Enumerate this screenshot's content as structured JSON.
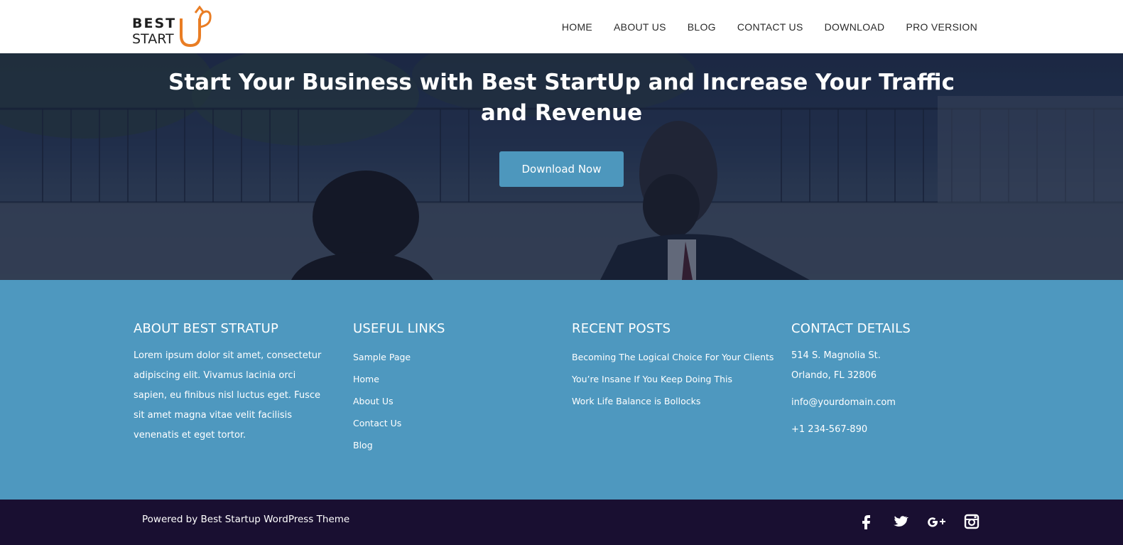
{
  "header": {
    "logo": {
      "best": "BEST",
      "start": "START",
      "up": "UP",
      "accent": "#e97d24"
    },
    "nav": [
      "HOME",
      "ABOUT US",
      "BLOG",
      "CONTACT US",
      "DOWNLOAD",
      "PRO VERSION"
    ]
  },
  "hero": {
    "title": "Start Your Business with Best StartUp and Increase Your Traffic and Revenue",
    "button": "Download Now"
  },
  "widgets": {
    "about": {
      "title": "ABOUT BEST STRATUP",
      "text": "Lorem ipsum dolor sit amet, consectetur adipiscing elit. Vivamus lacinia orci sapien, eu finibus nisl luctus eget. Fusce sit amet magna vitae velit facilisis venenatis et eget tortor."
    },
    "links": {
      "title": "USEFUL LINKS",
      "items": [
        "Sample Page",
        "Home",
        "About Us",
        "Contact Us",
        "Blog"
      ]
    },
    "posts": {
      "title": "RECENT POSTS",
      "items": [
        "Becoming The Logical Choice For Your Clients",
        "You’re Insane If You Keep Doing This",
        "Work Life Balance is Bollocks"
      ]
    },
    "contact": {
      "title": "CONTACT DETAILS",
      "address1": "514 S. Magnolia St.",
      "address2": "Orlando, FL 32806",
      "email": "info@yourdomain.com",
      "phone": "+1 234-567-890"
    }
  },
  "footer": {
    "powered": "Powered by Best Startup WordPress Theme",
    "social": [
      "facebook-icon",
      "twitter-icon",
      "google-plus-icon",
      "instagram-icon"
    ]
  },
  "colors": {
    "widget_bg": "#4e98bf",
    "bottom_bg": "#190f31",
    "button": "#4d97bd"
  }
}
